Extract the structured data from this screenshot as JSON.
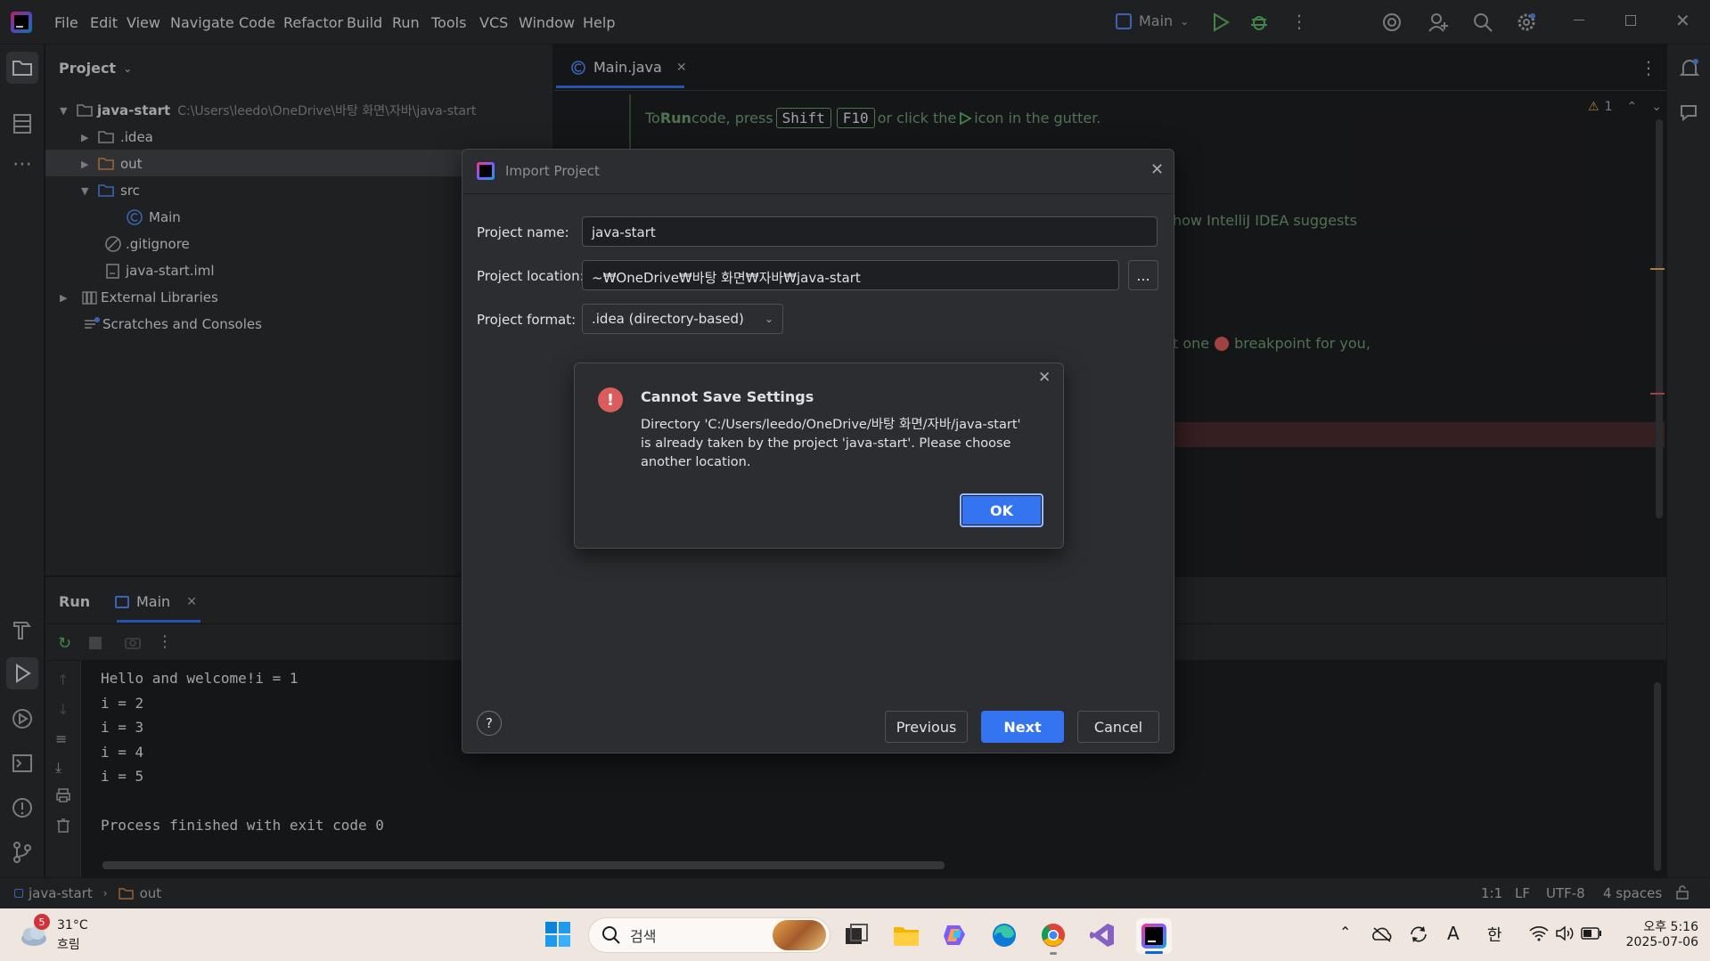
{
  "menu": [
    "File",
    "Edit",
    "View",
    "Navigate",
    "Code",
    "Refactor",
    "Build",
    "Run",
    "Tools",
    "VCS",
    "Window",
    "Help"
  ],
  "run_config": {
    "label": "Main"
  },
  "project_panel": {
    "title": "Project",
    "root": {
      "name": "java-start",
      "path": "C:\\Users\\leedo\\OneDrive\\바탕 화면\\자바\\java-start"
    },
    "items": [
      {
        "label": ".idea"
      },
      {
        "label": "out"
      },
      {
        "label": "src"
      },
      {
        "label": "Main"
      },
      {
        "label": ".gitignore"
      },
      {
        "label": "java-start.iml"
      },
      {
        "label": "External Libraries"
      },
      {
        "label": "Scratches and Consoles"
      }
    ]
  },
  "editor": {
    "tab": "Main.java",
    "hint": {
      "pre": "To ",
      "run": "Run",
      "mid": " code, press ",
      "key1": "Shift",
      "key2": "F10",
      "post": " or click the ",
      "tail": " icon in the gutter."
    },
    "partial1": "how IntelliJ IDEA suggests",
    "partial2a": "t one ",
    "partial2b": " breakpoint for you,",
    "warnings": "1"
  },
  "run_panel": {
    "title": "Run",
    "tab": "Main",
    "console": [
      "Hello and welcome!i = 1",
      "i = 2",
      "i = 3",
      "i = 4",
      "i = 5",
      "",
      "Process finished with exit code 0"
    ]
  },
  "import_dialog": {
    "title": "Import Project",
    "name_label": "Project name:",
    "name_value": "java-start",
    "location_label": "Project location:",
    "location_value": "~₩OneDrive₩바탕 화면₩자바₩java-start",
    "browse": "...",
    "format_label": "Project format:",
    "format_value": ".idea (directory-based)",
    "help": "?",
    "previous": "Previous",
    "next": "Next",
    "cancel": "Cancel"
  },
  "alert": {
    "title": "Cannot Save Settings",
    "message": "Directory 'C:/Users/leedo/OneDrive/바탕 화면/자바/java-start' is already taken by the project 'java-start'. Please choose another location.",
    "ok": "OK"
  },
  "statusbar": {
    "crumb1": "java-start",
    "crumb2": "out",
    "position": "1:1",
    "line_sep": "LF",
    "encoding": "UTF-8",
    "indent": "4 spaces"
  },
  "taskbar": {
    "weather_temp": "31°C",
    "weather_desc": "흐림",
    "weather_badge": "5",
    "search_placeholder": "검색",
    "ime1": "A",
    "ime2": "한",
    "time": "오후 5:16",
    "date": "2025-07-06"
  },
  "colors": {
    "accent": "#3574f0",
    "error": "#db5c5c",
    "run_green": "#5fb865",
    "bg": "#1e1f22",
    "panel": "#2b2d30"
  }
}
